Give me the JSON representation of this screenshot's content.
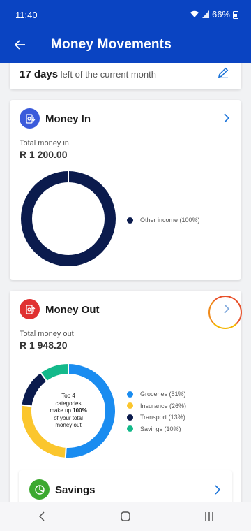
{
  "status": {
    "time": "11:40",
    "battery": "66%"
  },
  "header": {
    "title": "Money Movements"
  },
  "days_card": {
    "days": "17 days",
    "suffix": " left of the current month"
  },
  "money_in": {
    "title": "Money In",
    "total_label": "Total money in",
    "total_value": "R 1 200.00",
    "legend": [
      {
        "label": "Other income (100%)",
        "color": "#0b1b4d",
        "value": 100
      }
    ]
  },
  "money_out": {
    "title": "Money Out",
    "total_label": "Total money out",
    "total_value": "R 1 948.20",
    "center": {
      "line1": "Top 4",
      "line2": "categories",
      "line3_pre": "make up ",
      "line3_bold": "100%",
      "line4": "of your total",
      "line5": "money out"
    },
    "legend": [
      {
        "label": "Groceries (51%)",
        "color": "#1a8cf0",
        "value": 51
      },
      {
        "label": "Insurance (26%)",
        "color": "#fbc62d",
        "value": 26
      },
      {
        "label": "Transport (13%)",
        "color": "#0b1b4d",
        "value": 13
      },
      {
        "label": "Savings (10%)",
        "color": "#13b98a",
        "value": 10
      }
    ]
  },
  "savings": {
    "title": "Savings"
  },
  "icons": [
    "back-arrow-icon",
    "pencil-icon",
    "cash-in-icon",
    "cash-out-icon",
    "chevron-right-icon",
    "pie-chart-icon",
    "nav-back-icon",
    "nav-home-icon",
    "nav-recents-icon"
  ]
}
